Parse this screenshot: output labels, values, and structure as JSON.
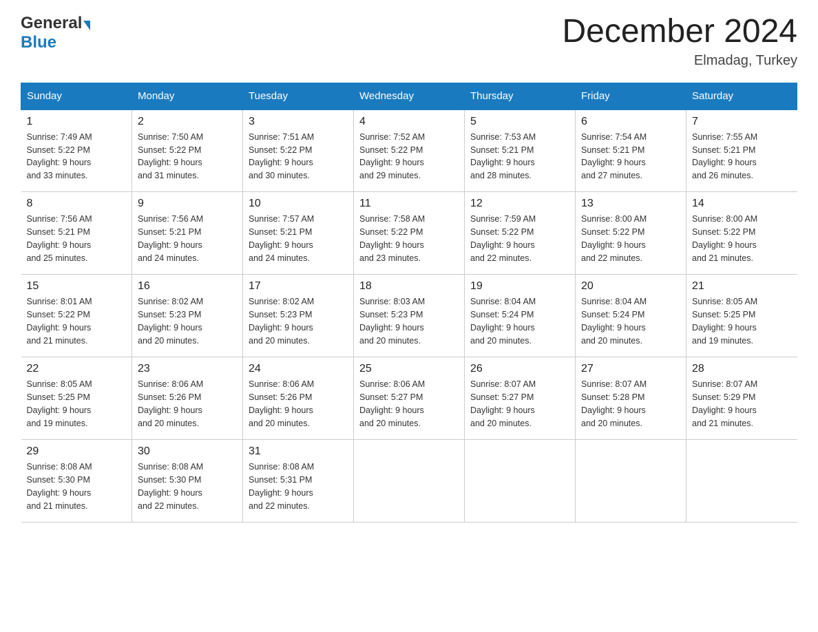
{
  "header": {
    "month_title": "December 2024",
    "location": "Elmadag, Turkey",
    "logo_general": "General",
    "logo_blue": "Blue"
  },
  "weekdays": [
    "Sunday",
    "Monday",
    "Tuesday",
    "Wednesday",
    "Thursday",
    "Friday",
    "Saturday"
  ],
  "weeks": [
    [
      {
        "day": "1",
        "sunrise": "7:49 AM",
        "sunset": "5:22 PM",
        "daylight": "9 hours and 33 minutes."
      },
      {
        "day": "2",
        "sunrise": "7:50 AM",
        "sunset": "5:22 PM",
        "daylight": "9 hours and 31 minutes."
      },
      {
        "day": "3",
        "sunrise": "7:51 AM",
        "sunset": "5:22 PM",
        "daylight": "9 hours and 30 minutes."
      },
      {
        "day": "4",
        "sunrise": "7:52 AM",
        "sunset": "5:22 PM",
        "daylight": "9 hours and 29 minutes."
      },
      {
        "day": "5",
        "sunrise": "7:53 AM",
        "sunset": "5:21 PM",
        "daylight": "9 hours and 28 minutes."
      },
      {
        "day": "6",
        "sunrise": "7:54 AM",
        "sunset": "5:21 PM",
        "daylight": "9 hours and 27 minutes."
      },
      {
        "day": "7",
        "sunrise": "7:55 AM",
        "sunset": "5:21 PM",
        "daylight": "9 hours and 26 minutes."
      }
    ],
    [
      {
        "day": "8",
        "sunrise": "7:56 AM",
        "sunset": "5:21 PM",
        "daylight": "9 hours and 25 minutes."
      },
      {
        "day": "9",
        "sunrise": "7:56 AM",
        "sunset": "5:21 PM",
        "daylight": "9 hours and 24 minutes."
      },
      {
        "day": "10",
        "sunrise": "7:57 AM",
        "sunset": "5:21 PM",
        "daylight": "9 hours and 24 minutes."
      },
      {
        "day": "11",
        "sunrise": "7:58 AM",
        "sunset": "5:22 PM",
        "daylight": "9 hours and 23 minutes."
      },
      {
        "day": "12",
        "sunrise": "7:59 AM",
        "sunset": "5:22 PM",
        "daylight": "9 hours and 22 minutes."
      },
      {
        "day": "13",
        "sunrise": "8:00 AM",
        "sunset": "5:22 PM",
        "daylight": "9 hours and 22 minutes."
      },
      {
        "day": "14",
        "sunrise": "8:00 AM",
        "sunset": "5:22 PM",
        "daylight": "9 hours and 21 minutes."
      }
    ],
    [
      {
        "day": "15",
        "sunrise": "8:01 AM",
        "sunset": "5:22 PM",
        "daylight": "9 hours and 21 minutes."
      },
      {
        "day": "16",
        "sunrise": "8:02 AM",
        "sunset": "5:23 PM",
        "daylight": "9 hours and 20 minutes."
      },
      {
        "day": "17",
        "sunrise": "8:02 AM",
        "sunset": "5:23 PM",
        "daylight": "9 hours and 20 minutes."
      },
      {
        "day": "18",
        "sunrise": "8:03 AM",
        "sunset": "5:23 PM",
        "daylight": "9 hours and 20 minutes."
      },
      {
        "day": "19",
        "sunrise": "8:04 AM",
        "sunset": "5:24 PM",
        "daylight": "9 hours and 20 minutes."
      },
      {
        "day": "20",
        "sunrise": "8:04 AM",
        "sunset": "5:24 PM",
        "daylight": "9 hours and 20 minutes."
      },
      {
        "day": "21",
        "sunrise": "8:05 AM",
        "sunset": "5:25 PM",
        "daylight": "9 hours and 19 minutes."
      }
    ],
    [
      {
        "day": "22",
        "sunrise": "8:05 AM",
        "sunset": "5:25 PM",
        "daylight": "9 hours and 19 minutes."
      },
      {
        "day": "23",
        "sunrise": "8:06 AM",
        "sunset": "5:26 PM",
        "daylight": "9 hours and 20 minutes."
      },
      {
        "day": "24",
        "sunrise": "8:06 AM",
        "sunset": "5:26 PM",
        "daylight": "9 hours and 20 minutes."
      },
      {
        "day": "25",
        "sunrise": "8:06 AM",
        "sunset": "5:27 PM",
        "daylight": "9 hours and 20 minutes."
      },
      {
        "day": "26",
        "sunrise": "8:07 AM",
        "sunset": "5:27 PM",
        "daylight": "9 hours and 20 minutes."
      },
      {
        "day": "27",
        "sunrise": "8:07 AM",
        "sunset": "5:28 PM",
        "daylight": "9 hours and 20 minutes."
      },
      {
        "day": "28",
        "sunrise": "8:07 AM",
        "sunset": "5:29 PM",
        "daylight": "9 hours and 21 minutes."
      }
    ],
    [
      {
        "day": "29",
        "sunrise": "8:08 AM",
        "sunset": "5:30 PM",
        "daylight": "9 hours and 21 minutes."
      },
      {
        "day": "30",
        "sunrise": "8:08 AM",
        "sunset": "5:30 PM",
        "daylight": "9 hours and 22 minutes."
      },
      {
        "day": "31",
        "sunrise": "8:08 AM",
        "sunset": "5:31 PM",
        "daylight": "9 hours and 22 minutes."
      },
      null,
      null,
      null,
      null
    ]
  ],
  "labels": {
    "sunrise": "Sunrise:",
    "sunset": "Sunset:",
    "daylight": "Daylight:"
  }
}
